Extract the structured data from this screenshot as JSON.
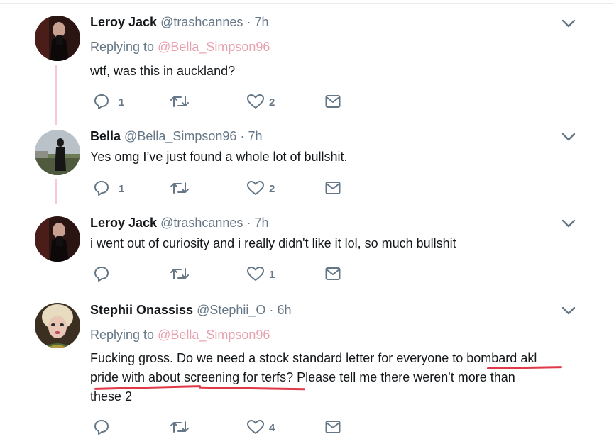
{
  "tweets": [
    {
      "name": "Leroy Jack",
      "handle": "@trashcannes",
      "dot": "·",
      "time": "7h",
      "replying_label": "Replying to",
      "replying_to": "@Bella_Simpson96",
      "text": "wtf, was this in auckland?",
      "reply_count": "1",
      "retweet_count": "",
      "like_count": "2"
    },
    {
      "name": "Bella",
      "handle": "@Bella_Simpson96",
      "dot": "·",
      "time": "7h",
      "text": "Yes omg I’ve just found a whole lot of bullshit.",
      "reply_count": "1",
      "retweet_count": "",
      "like_count": "2"
    },
    {
      "name": "Leroy Jack",
      "handle": "@trashcannes",
      "dot": "·",
      "time": "7h",
      "text": "i went out of curiosity and i really didn't like it lol, so much bullshit",
      "reply_count": "",
      "retweet_count": "",
      "like_count": "1"
    },
    {
      "name": "Stephii Onassiss",
      "handle": "@Stephii_O",
      "dot": "·",
      "time": "6h",
      "replying_label": "Replying to",
      "replying_to": "@Bella_Simpson96",
      "text_line1": "Fucking gross. Do we need a stock standard letter for everyone to bombard akl",
      "text_line2": "pride with about screening for terfs? Please tell me there weren't more than",
      "text_line3": "these 2",
      "reply_count": "",
      "retweet_count": "",
      "like_count": "4"
    }
  ],
  "colors": {
    "mention": "#e8a0b0",
    "thread_line": "#f6c9d3",
    "underline": "#e03a4a",
    "secondary_text": "#657786"
  },
  "icons": [
    "reply-icon",
    "retweet-icon",
    "like-icon",
    "message-icon",
    "chevron-down-icon"
  ]
}
